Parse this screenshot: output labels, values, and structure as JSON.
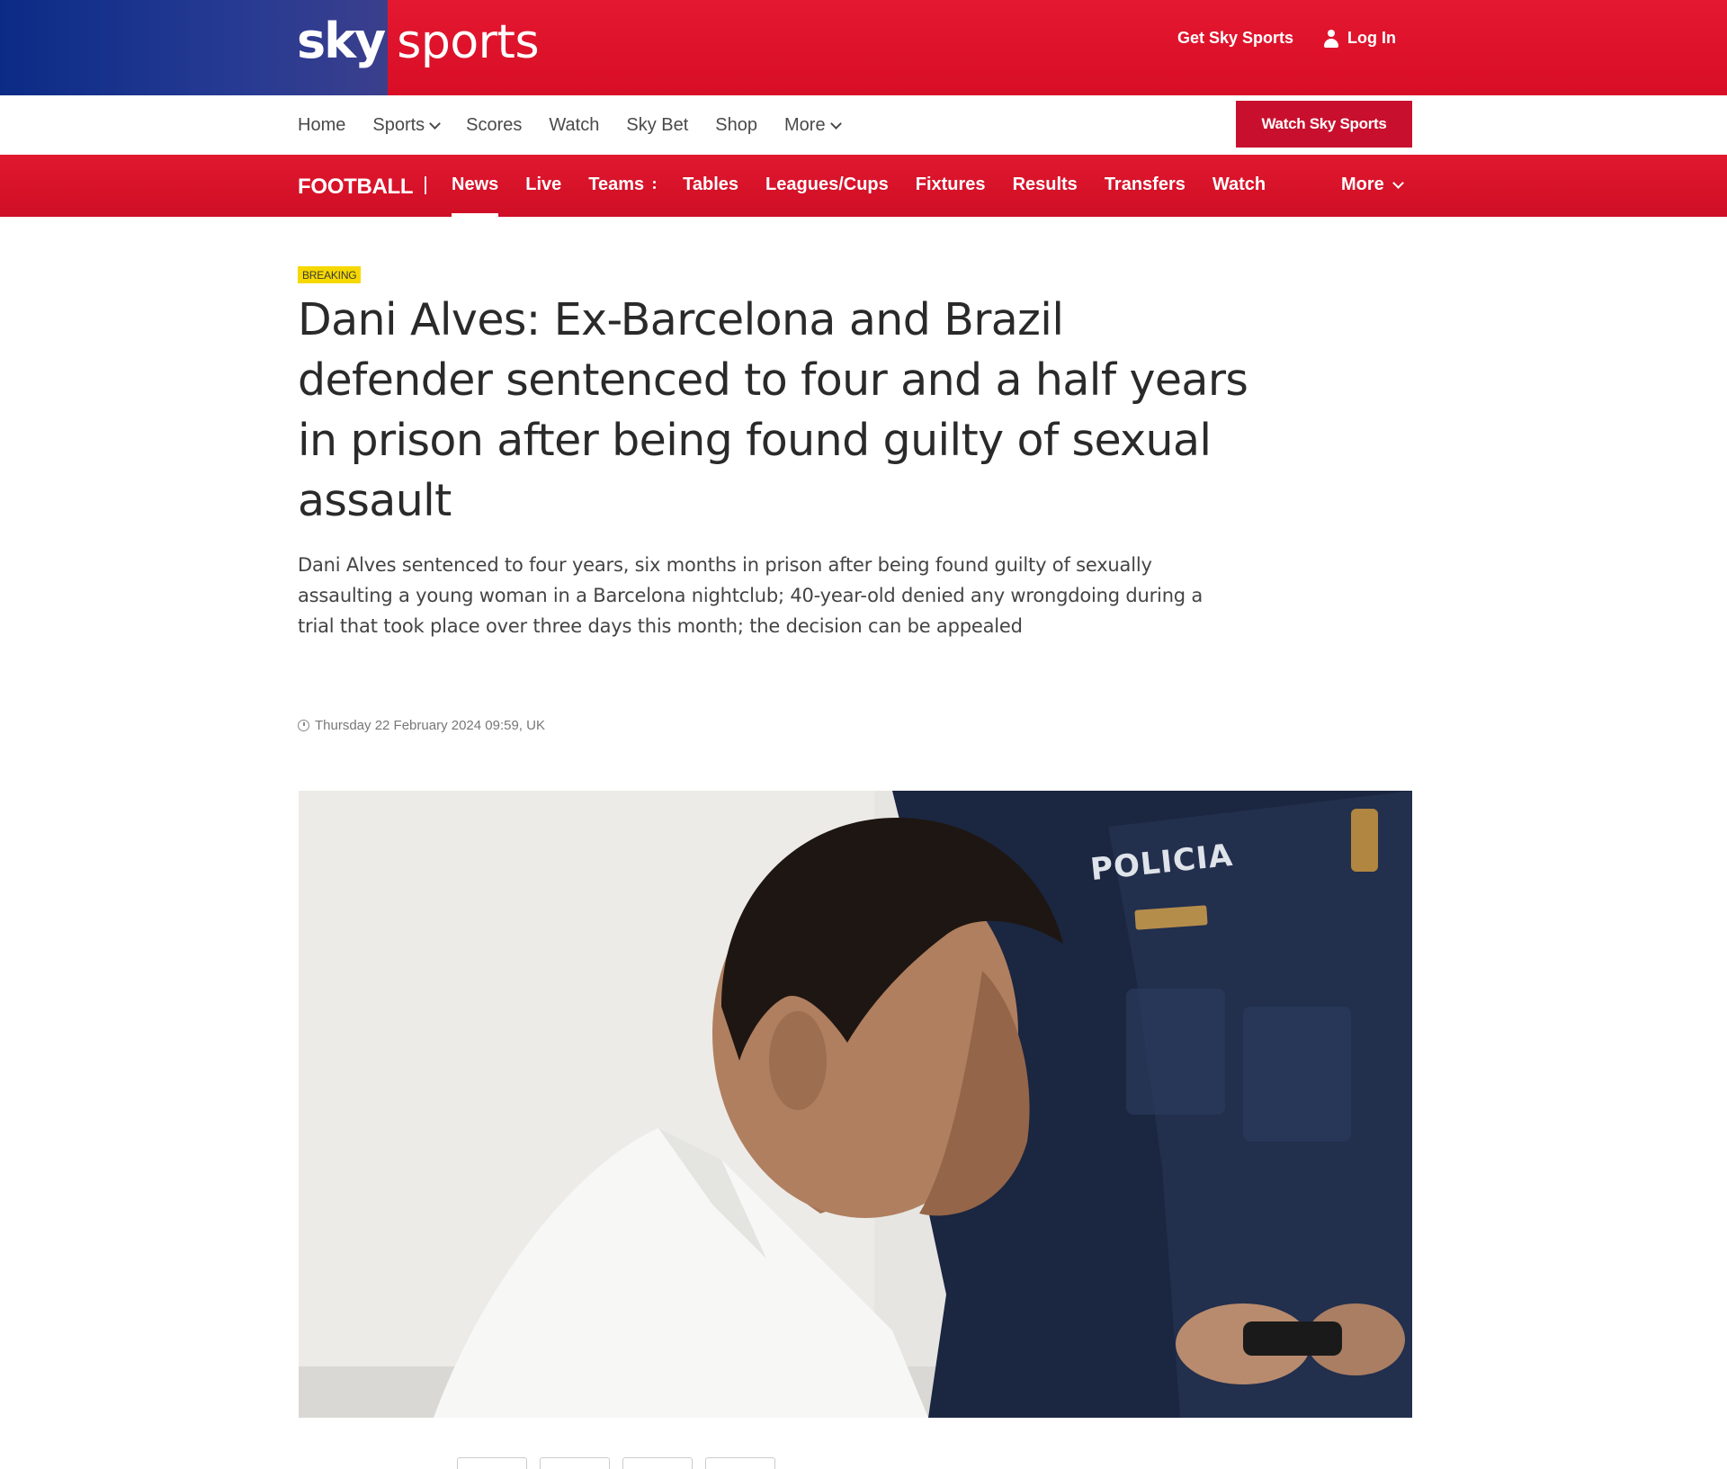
{
  "brand": {
    "sky": "sky",
    "sports": "sports"
  },
  "top_actions": {
    "get": "Get Sky Sports",
    "login": "Log In"
  },
  "subnav": {
    "items": [
      {
        "label": "Home",
        "dropdown": false
      },
      {
        "label": "Sports",
        "dropdown": true
      },
      {
        "label": "Scores",
        "dropdown": false
      },
      {
        "label": "Watch",
        "dropdown": false
      },
      {
        "label": "Sky Bet",
        "dropdown": false
      },
      {
        "label": "Shop",
        "dropdown": false
      },
      {
        "label": "More",
        "dropdown": true
      }
    ],
    "watch_button": "Watch Sky Sports"
  },
  "football_nav": {
    "section": "FOOTBALL",
    "items": [
      "News",
      "Live",
      "Teams",
      "Tables",
      "Leagues/Cups",
      "Fixtures",
      "Results",
      "Transfers",
      "Watch"
    ],
    "active": "News",
    "more": "More"
  },
  "article": {
    "badge": "BREAKING",
    "headline": "Dani Alves: Ex-Barcelona and Brazil defender sentenced to four and a half years in prison after being found guilty of sexual assault",
    "standfirst": "Dani Alves sentenced to four years, six months in prison after being found guilty of sexually assaulting a young woman in a Barcelona nightclub; 40-year-old denied any wrongdoing during a trial that took place over three days this month; the decision can be appealed",
    "date": "Thursday 22 February 2024 09:59, UK",
    "image_text": "POLICIA"
  },
  "colors": {
    "brand_red": "#e2112f",
    "brand_blue": "#0b2b86",
    "badge_yellow": "#f6d800",
    "button_red": "#c8102e"
  },
  "icons": [
    "user-icon",
    "chevron-down-icon",
    "clock-icon",
    "dots-icon"
  ]
}
